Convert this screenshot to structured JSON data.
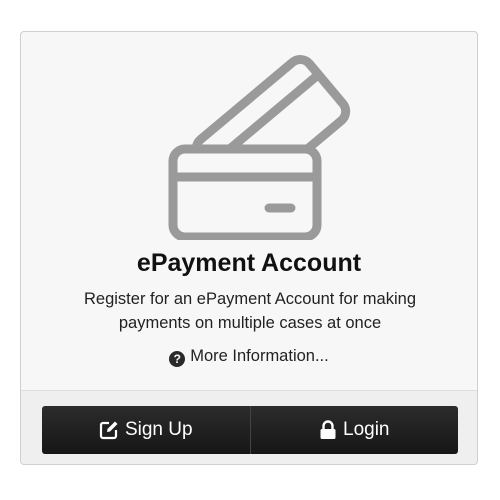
{
  "card": {
    "title": "ePayment Account",
    "description": "Register for an ePayment Account for making payments on multiple cases at once",
    "more_info_label": "More Information...",
    "illustration_icon": "credit-cards-icon"
  },
  "actions": {
    "signup_label": "Sign Up",
    "signup_icon": "edit-icon",
    "login_label": "Login",
    "login_icon": "lock-icon"
  },
  "colors": {
    "icon_gray": "#9a9a9a",
    "button_bg": "#1e1e1e",
    "button_text": "#ffffff",
    "card_bg": "#f7f7f7"
  }
}
